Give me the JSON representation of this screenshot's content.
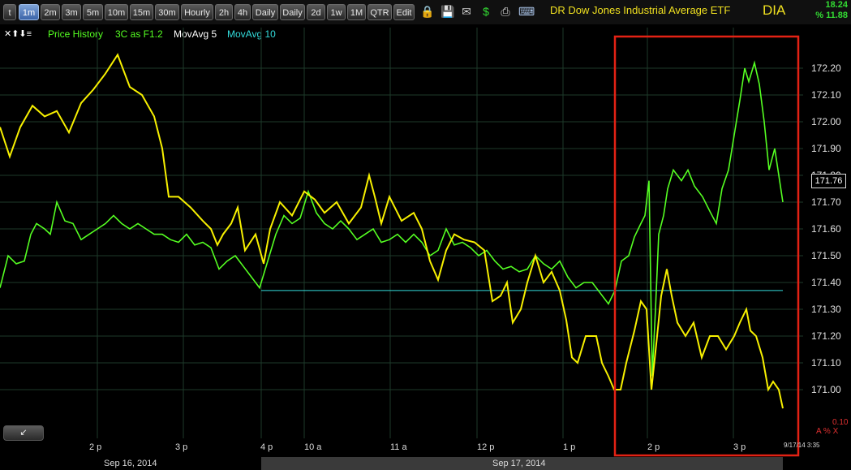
{
  "toolbar": {
    "buttons": [
      "t",
      "1m",
      "2m",
      "3m",
      "5m",
      "10m",
      "15m",
      "30m",
      "Hourly",
      "2h",
      "4h",
      "Daily",
      "Daily",
      "2d",
      "1w",
      "1M",
      "QTR",
      "Edit"
    ],
    "active_index": 1,
    "icons": [
      "lock-icon",
      "save-icon",
      "mail-icon",
      "dollar-icon",
      "print-icon",
      "keyboard-icon"
    ],
    "icon_glyphs": [
      "🔒",
      "💾",
      "✉",
      "$",
      "⎙",
      "⌨"
    ],
    "title": "DR Dow Jones Industrial Average ETF",
    "symbol": "DIA",
    "change_1": "18.24",
    "change_2": "% 11.88"
  },
  "legend": {
    "controls": "✕⬆⬇≡",
    "price_history": "Price History",
    "overlay": "3C as F1.2",
    "movavg5": "MovAvg 5",
    "movavg10": "MovAvg 10"
  },
  "colors": {
    "price": "#f7f000",
    "indicator": "#55ff22",
    "movavg10": "#33dddd",
    "highlight": "#e32214",
    "grid": "#1e3a2a"
  },
  "x_axis": {
    "labels": [
      "2 p",
      "3 p",
      "4 p",
      "10 a",
      "11 a",
      "12 p",
      "1 p",
      "2 p",
      "3 p"
    ],
    "dates": [
      "Sep 16, 2014",
      "Sep 17, 2014"
    ],
    "timestamp": "9/17/14 3:35"
  },
  "price_axis": {
    "labels": [
      "172.20",
      "172.10",
      "172.00",
      "171.90",
      "171.80",
      "171.70",
      "171.60",
      "171.50",
      "171.40",
      "171.30",
      "171.20",
      "171.10",
      "171.00"
    ],
    "last_price": "171.76"
  },
  "bottom": {
    "scroll_button": "↙",
    "right_value": "0.10",
    "right_label": "A % X"
  },
  "chart_data": {
    "type": "line",
    "y_unit": "price",
    "ylim": [
      170.92,
      172.32
    ],
    "series": [
      {
        "name": "Price History",
        "color": "#f7f000",
        "points": [
          [
            0,
            171.98
          ],
          [
            12,
            171.87
          ],
          [
            25,
            171.98
          ],
          [
            40,
            172.06
          ],
          [
            55,
            172.02
          ],
          [
            70,
            172.04
          ],
          [
            85,
            171.96
          ],
          [
            100,
            172.07
          ],
          [
            115,
            172.12
          ],
          [
            130,
            172.18
          ],
          [
            145,
            172.25
          ],
          [
            160,
            172.13
          ],
          [
            175,
            172.1
          ],
          [
            190,
            172.02
          ],
          [
            200,
            171.9
          ],
          [
            208,
            171.72
          ],
          [
            220,
            171.72
          ],
          [
            235,
            171.68
          ],
          [
            250,
            171.63
          ],
          [
            260,
            171.6
          ],
          [
            268,
            171.54
          ],
          [
            275,
            171.58
          ],
          [
            285,
            171.62
          ],
          [
            293,
            171.68
          ],
          [
            302,
            171.52
          ],
          [
            315,
            171.58
          ],
          [
            325,
            171.47
          ],
          [
            333,
            171.6
          ],
          [
            345,
            171.7
          ],
          [
            360,
            171.65
          ],
          [
            375,
            171.74
          ],
          [
            388,
            171.71
          ],
          [
            400,
            171.66
          ],
          [
            415,
            171.7
          ],
          [
            430,
            171.62
          ],
          [
            445,
            171.68
          ],
          [
            455,
            171.8
          ],
          [
            462,
            171.72
          ],
          [
            470,
            171.62
          ],
          [
            480,
            171.72
          ],
          [
            495,
            171.63
          ],
          [
            510,
            171.66
          ],
          [
            520,
            171.6
          ],
          [
            530,
            171.48
          ],
          [
            540,
            171.41
          ],
          [
            550,
            171.52
          ],
          [
            560,
            171.58
          ],
          [
            572,
            171.56
          ],
          [
            585,
            171.55
          ],
          [
            597,
            171.52
          ],
          [
            607,
            171.33
          ],
          [
            617,
            171.35
          ],
          [
            625,
            171.4
          ],
          [
            632,
            171.25
          ],
          [
            642,
            171.3
          ],
          [
            650,
            171.4
          ],
          [
            660,
            171.5
          ],
          [
            670,
            171.4
          ],
          [
            680,
            171.44
          ],
          [
            690,
            171.37
          ],
          [
            698,
            171.26
          ],
          [
            705,
            171.12
          ],
          [
            712,
            171.1
          ],
          [
            722,
            171.2
          ],
          [
            735,
            171.2
          ],
          [
            742,
            171.1
          ],
          [
            750,
            171.05
          ],
          [
            757,
            171.0
          ],
          [
            765,
            171.0
          ],
          [
            772,
            171.1
          ],
          [
            782,
            171.22
          ],
          [
            790,
            171.33
          ],
          [
            797,
            171.3
          ],
          [
            803,
            171.0
          ],
          [
            810,
            171.2
          ],
          [
            815,
            171.35
          ],
          [
            822,
            171.45
          ],
          [
            828,
            171.35
          ],
          [
            835,
            171.25
          ],
          [
            845,
            171.2
          ],
          [
            855,
            171.25
          ],
          [
            865,
            171.12
          ],
          [
            875,
            171.2
          ],
          [
            885,
            171.2
          ],
          [
            895,
            171.15
          ],
          [
            905,
            171.2
          ],
          [
            912,
            171.25
          ],
          [
            920,
            171.3
          ],
          [
            925,
            171.22
          ],
          [
            932,
            171.2
          ],
          [
            940,
            171.12
          ],
          [
            947,
            171.0
          ],
          [
            953,
            171.03
          ],
          [
            960,
            171.0
          ],
          [
            965,
            170.93
          ]
        ]
      },
      {
        "name": "3C as F1.2",
        "color": "#55ff22",
        "points": [
          [
            0,
            171.38
          ],
          [
            10,
            171.5
          ],
          [
            20,
            171.47
          ],
          [
            30,
            171.48
          ],
          [
            38,
            171.58
          ],
          [
            45,
            171.62
          ],
          [
            55,
            171.6
          ],
          [
            62,
            171.58
          ],
          [
            70,
            171.7
          ],
          [
            80,
            171.63
          ],
          [
            90,
            171.62
          ],
          [
            100,
            171.56
          ],
          [
            110,
            171.58
          ],
          [
            120,
            171.6
          ],
          [
            130,
            171.62
          ],
          [
            140,
            171.65
          ],
          [
            150,
            171.62
          ],
          [
            160,
            171.6
          ],
          [
            170,
            171.62
          ],
          [
            180,
            171.6
          ],
          [
            190,
            171.58
          ],
          [
            200,
            171.58
          ],
          [
            210,
            171.56
          ],
          [
            220,
            171.55
          ],
          [
            230,
            171.58
          ],
          [
            240,
            171.54
          ],
          [
            250,
            171.55
          ],
          [
            260,
            171.53
          ],
          [
            270,
            171.45
          ],
          [
            280,
            171.48
          ],
          [
            290,
            171.5
          ],
          [
            300,
            171.46
          ],
          [
            310,
            171.42
          ],
          [
            320,
            171.38
          ],
          [
            330,
            171.48
          ],
          [
            340,
            171.58
          ],
          [
            350,
            171.65
          ],
          [
            360,
            171.62
          ],
          [
            370,
            171.64
          ],
          [
            380,
            171.74
          ],
          [
            390,
            171.66
          ],
          [
            400,
            171.62
          ],
          [
            410,
            171.6
          ],
          [
            420,
            171.63
          ],
          [
            430,
            171.6
          ],
          [
            440,
            171.56
          ],
          [
            450,
            171.58
          ],
          [
            460,
            171.6
          ],
          [
            470,
            171.55
          ],
          [
            480,
            171.56
          ],
          [
            490,
            171.58
          ],
          [
            500,
            171.55
          ],
          [
            510,
            171.58
          ],
          [
            520,
            171.55
          ],
          [
            530,
            171.5
          ],
          [
            540,
            171.52
          ],
          [
            550,
            171.6
          ],
          [
            560,
            171.54
          ],
          [
            570,
            171.55
          ],
          [
            580,
            171.53
          ],
          [
            590,
            171.5
          ],
          [
            600,
            171.52
          ],
          [
            610,
            171.48
          ],
          [
            620,
            171.45
          ],
          [
            630,
            171.46
          ],
          [
            640,
            171.44
          ],
          [
            650,
            171.45
          ],
          [
            660,
            171.5
          ],
          [
            670,
            171.47
          ],
          [
            680,
            171.45
          ],
          [
            690,
            171.48
          ],
          [
            700,
            171.42
          ],
          [
            710,
            171.38
          ],
          [
            720,
            171.4
          ],
          [
            730,
            171.4
          ],
          [
            740,
            171.36
          ],
          [
            750,
            171.32
          ],
          [
            758,
            171.37
          ],
          [
            766,
            171.48
          ],
          [
            775,
            171.5
          ],
          [
            782,
            171.57
          ],
          [
            790,
            171.62
          ],
          [
            795,
            171.65
          ],
          [
            800,
            171.78
          ],
          [
            804,
            171.05
          ],
          [
            808,
            171.3
          ],
          [
            812,
            171.58
          ],
          [
            818,
            171.65
          ],
          [
            823,
            171.75
          ],
          [
            830,
            171.82
          ],
          [
            840,
            171.78
          ],
          [
            848,
            171.82
          ],
          [
            856,
            171.76
          ],
          [
            866,
            171.72
          ],
          [
            876,
            171.66
          ],
          [
            883,
            171.62
          ],
          [
            890,
            171.75
          ],
          [
            898,
            171.82
          ],
          [
            905,
            171.95
          ],
          [
            912,
            172.08
          ],
          [
            918,
            172.2
          ],
          [
            923,
            172.15
          ],
          [
            930,
            172.22
          ],
          [
            936,
            172.14
          ],
          [
            942,
            172.0
          ],
          [
            948,
            171.82
          ],
          [
            955,
            171.9
          ],
          [
            960,
            171.8
          ],
          [
            965,
            171.7
          ]
        ]
      }
    ],
    "reference_line": {
      "name": "MovAvg 10",
      "y": 171.37,
      "x_start": 322,
      "x_end": 965
    }
  }
}
